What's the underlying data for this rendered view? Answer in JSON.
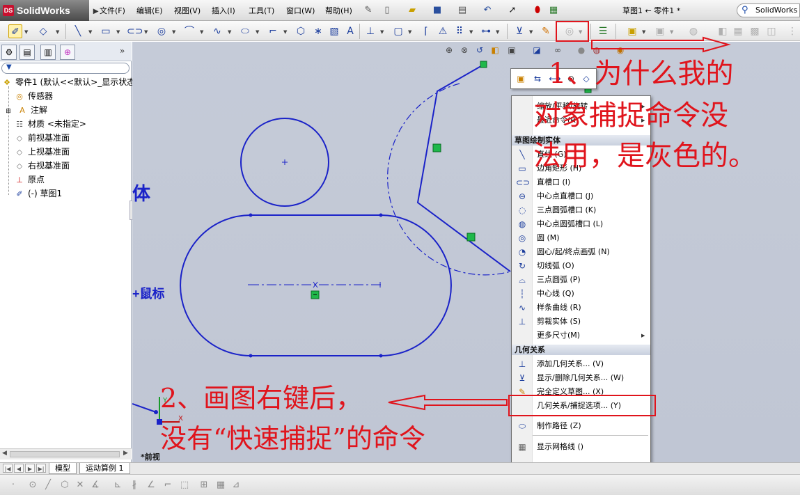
{
  "app": {
    "logo": "SolidWorks",
    "menu": [
      "文件(F)",
      "编辑(E)",
      "视图(V)",
      "插入(I)",
      "工具(T)",
      "窗口(W)",
      "帮助(H)"
    ],
    "document_title": "草图1 ← 零件1 *",
    "search_label": "SolidWorks 搜"
  },
  "feature_tree": {
    "root": "零件1  (默认<<默认>_显示状态",
    "items": [
      {
        "label": "传感器",
        "icon": "sensor-icon"
      },
      {
        "label": "注解",
        "icon": "annotation-icon"
      },
      {
        "label": "材质 <未指定>",
        "icon": "material-icon"
      },
      {
        "label": "前视基准面",
        "icon": "plane-icon"
      },
      {
        "label": "上视基准面",
        "icon": "plane-icon"
      },
      {
        "label": "右视基准面",
        "icon": "plane-icon"
      },
      {
        "label": "原点",
        "icon": "origin-icon"
      },
      {
        "label": "(-) 草图1",
        "icon": "sketch-icon"
      }
    ]
  },
  "canvas": {
    "fragment_1": "体",
    "fragment_2": "+鼠标",
    "view_label": "*前视"
  },
  "context_menu": {
    "top_items": [
      {
        "label": "缩放/平移/旋转",
        "has_sub": true
      },
      {
        "label": "最近命令(R)",
        "has_sub": true
      }
    ],
    "section_sketch": "草图绘制实体",
    "sketch_items": [
      {
        "label": "直线 (G)",
        "icon": "line-icon"
      },
      {
        "label": "边角矩形 (H)",
        "icon": "rectangle-icon"
      },
      {
        "label": "直槽口 (I)",
        "icon": "straight-slot-icon"
      },
      {
        "label": "中心点直槽口 (J)",
        "icon": "center-slot-icon"
      },
      {
        "label": "三点圆弧槽口 (K)",
        "icon": "arc-slot-icon"
      },
      {
        "label": "中心点圆弧槽口 (L)",
        "icon": "center-arc-slot-icon"
      },
      {
        "label": "圆 (M)",
        "icon": "circle-icon"
      },
      {
        "label": "圆心/起/终点画弧 (N)",
        "icon": "center-arc-icon"
      },
      {
        "label": "切线弧 (O)",
        "icon": "tangent-arc-icon"
      },
      {
        "label": "三点圆弧 (P)",
        "icon": "three-point-arc-icon"
      },
      {
        "label": "中心线 (Q)",
        "icon": "centerline-icon"
      },
      {
        "label": "样条曲线 (R)",
        "icon": "spline-icon"
      },
      {
        "label": "剪裁实体 (S)",
        "icon": "trim-icon"
      },
      {
        "label": "更多尺寸(M)",
        "icon": "",
        "has_sub": true
      }
    ],
    "section_relations": "几何关系",
    "relation_items": [
      {
        "label": "添加几何关系... (V)",
        "icon": "add-relation-icon"
      },
      {
        "label": "显示/删除几何关系... (W)",
        "icon": "display-relations-icon"
      },
      {
        "label": "完全定义草图... (X)",
        "icon": "fully-define-icon"
      },
      {
        "label": "几何关系/捕捉选项... (Y)",
        "icon": ""
      }
    ],
    "bottom_items": [
      {
        "label": "制作路径 (Z)",
        "icon": "make-path-icon"
      },
      {
        "label": "显示网格线 ()",
        "icon": "grid-icon"
      }
    ],
    "more": "»"
  },
  "annotations": {
    "note_1": [
      "1、为什么我的",
      "对象捕捉命令没",
      "法用，是灰色的。"
    ],
    "note_2": [
      "2、画图右键后，",
      "没有“快速捕捉”的命令"
    ],
    "color": "#e0141c"
  },
  "bottom_tabs": [
    "模型",
    "运动算例 1"
  ],
  "colors": {
    "sketch_line": "#1a22c8",
    "canvas_bg": "#c3c9d6",
    "relation_green": "#1fb84a"
  }
}
